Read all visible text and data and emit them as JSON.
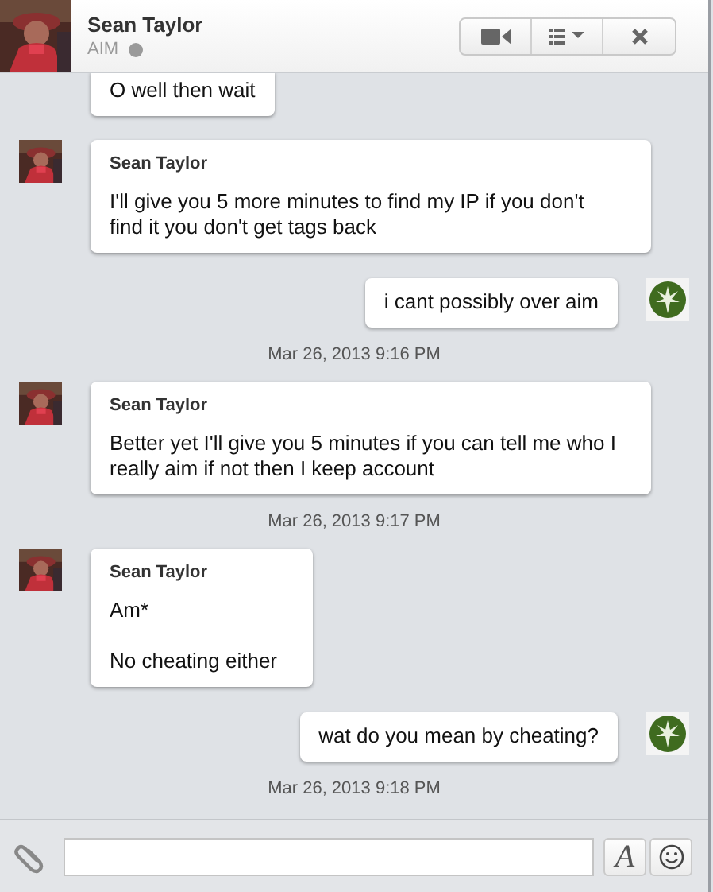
{
  "header": {
    "name": "Sean Taylor",
    "service": "AIM",
    "online": false
  },
  "messages": [
    {
      "kind": "continued",
      "text": "O well then wait"
    },
    {
      "kind": "incoming",
      "sender": "Sean Taylor",
      "text": "I'll give you 5 more minutes to find my IP if you don't find it you don't get tags back"
    },
    {
      "kind": "outgoing",
      "text": "i cant possibly over aim"
    },
    {
      "kind": "timestamp",
      "text": "Mar 26, 2013 9:16 PM"
    },
    {
      "kind": "incoming",
      "sender": "Sean Taylor",
      "text": "Better yet I'll give you 5 minutes if you can tell me who I really aim if not then I keep account"
    },
    {
      "kind": "timestamp",
      "text": "Mar 26, 2013 9:17 PM"
    },
    {
      "kind": "incoming",
      "sender": "Sean Taylor",
      "text": "Am*\n\nNo cheating either"
    },
    {
      "kind": "outgoing",
      "text": "wat do you mean by cheating?"
    },
    {
      "kind": "timestamp",
      "text": "Mar 26, 2013 9:18 PM"
    }
  ],
  "compose": {
    "font_button": "A"
  }
}
